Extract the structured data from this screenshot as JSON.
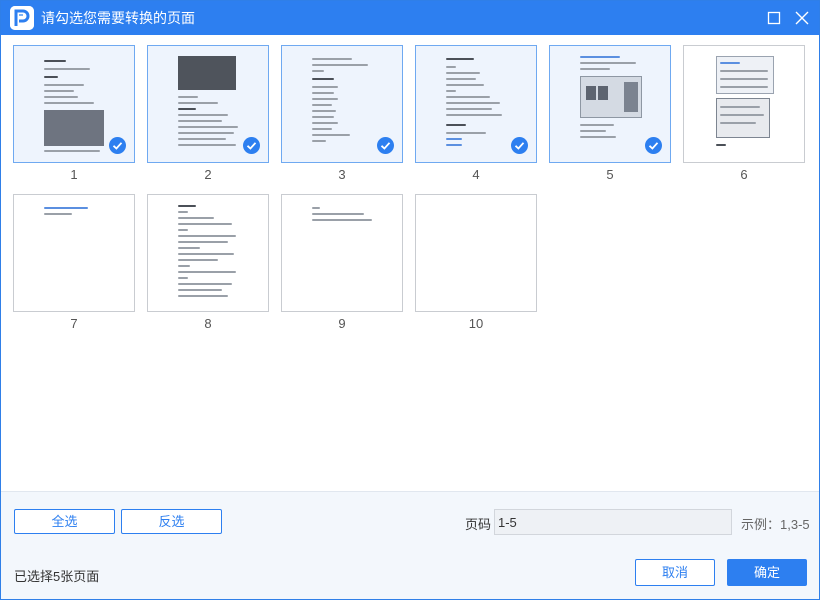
{
  "window": {
    "title": "请勾选您需要转换的页面"
  },
  "pages": [
    {
      "number": "1",
      "selected": true
    },
    {
      "number": "2",
      "selected": true
    },
    {
      "number": "3",
      "selected": true
    },
    {
      "number": "4",
      "selected": true
    },
    {
      "number": "5",
      "selected": true
    },
    {
      "number": "6",
      "selected": false
    },
    {
      "number": "7",
      "selected": false
    },
    {
      "number": "8",
      "selected": false
    },
    {
      "number": "9",
      "selected": false
    },
    {
      "number": "10",
      "selected": false
    }
  ],
  "footer": {
    "select_all_label": "全选",
    "invert_label": "反选",
    "page_range_label": "页码",
    "page_range_value": "1-5",
    "example_text": "示例：1,3-5",
    "selected_count_text": "已选择5张页面",
    "cancel_label": "取消",
    "ok_label": "确定"
  },
  "colors": {
    "accent": "#2d7ff0",
    "selected_border": "#6fa9f1",
    "selected_bg": "#eef4fd"
  },
  "icons": {
    "logo": "app-logo-icon",
    "maximize": "maximize-icon",
    "close": "close-icon",
    "check": "check-icon"
  }
}
